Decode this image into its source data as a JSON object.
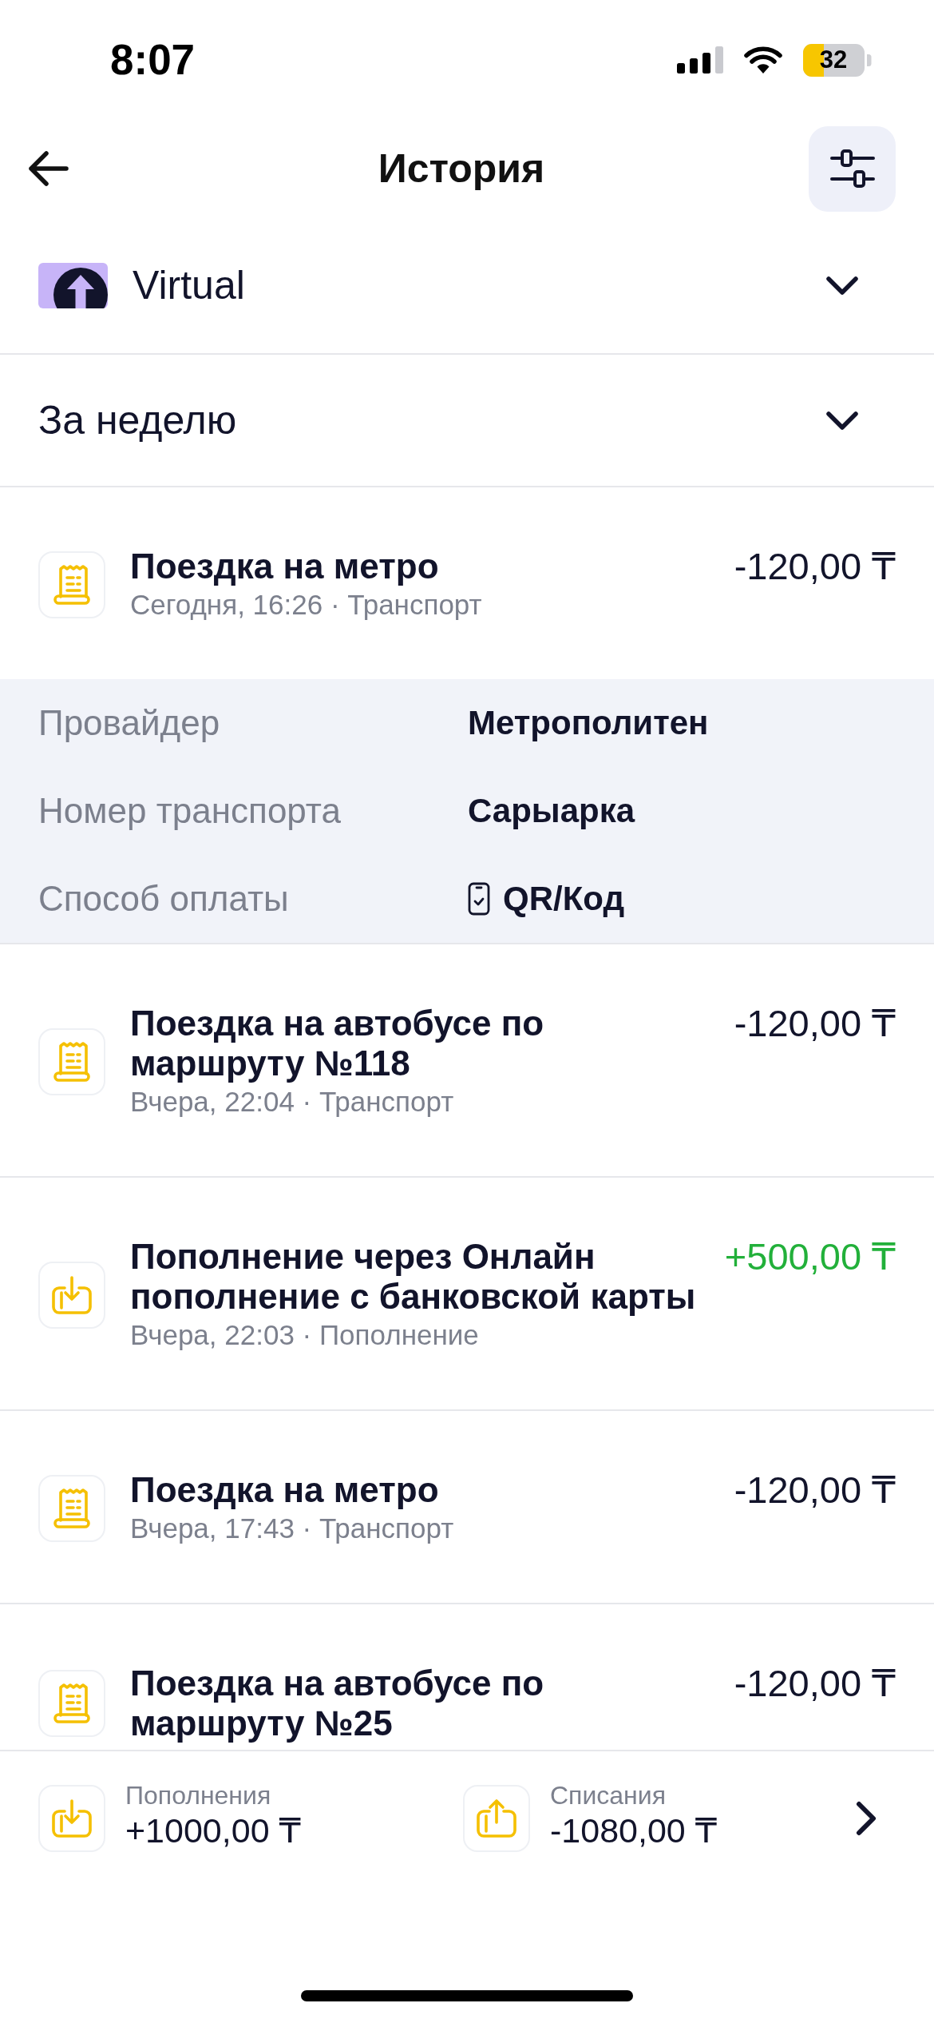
{
  "status_bar": {
    "time": "8:07",
    "battery": "32"
  },
  "header": {
    "title": "История"
  },
  "account": {
    "name": "Virtual"
  },
  "period": {
    "label": "За неделю"
  },
  "transactions": [
    {
      "kind": "trip",
      "title": "Поездка на метро",
      "meta": "Сегодня, 16:26 · Транспорт",
      "amount": "-120,00 ₸",
      "details": [
        {
          "kind": "text",
          "label": "Провайдер",
          "value": "Метрополитен"
        },
        {
          "kind": "text",
          "label": "Номер транспорта",
          "value": "Сарыарка"
        },
        {
          "kind": "method",
          "label": "Способ оплаты",
          "value": "QR/Код"
        }
      ]
    },
    {
      "kind": "trip",
      "title": "Поездка на автобусе по маршруту №118",
      "meta": "Вчера, 22:04 · Транспорт",
      "amount": "-120,00 ₸"
    },
    {
      "kind": "topup",
      "title": "Пополнение через Онлайн пополнение с банковской карты",
      "meta": "Вчера, 22:03 · Пополнение",
      "amount": "+500,00 ₸"
    },
    {
      "kind": "trip",
      "title": "Поездка на метро",
      "meta": "Вчера, 17:43 · Транспорт",
      "amount": "-120,00 ₸"
    },
    {
      "kind": "trip",
      "title": "Поездка на автобусе по маршруту №25",
      "amount": "-120,00 ₸"
    }
  ],
  "summary": [
    {
      "kind": "income",
      "label": "Пополнения",
      "value": "+1000,00 ₸"
    },
    {
      "kind": "expense",
      "label": "Списания",
      "value": "-1080,00 ₸"
    }
  ]
}
